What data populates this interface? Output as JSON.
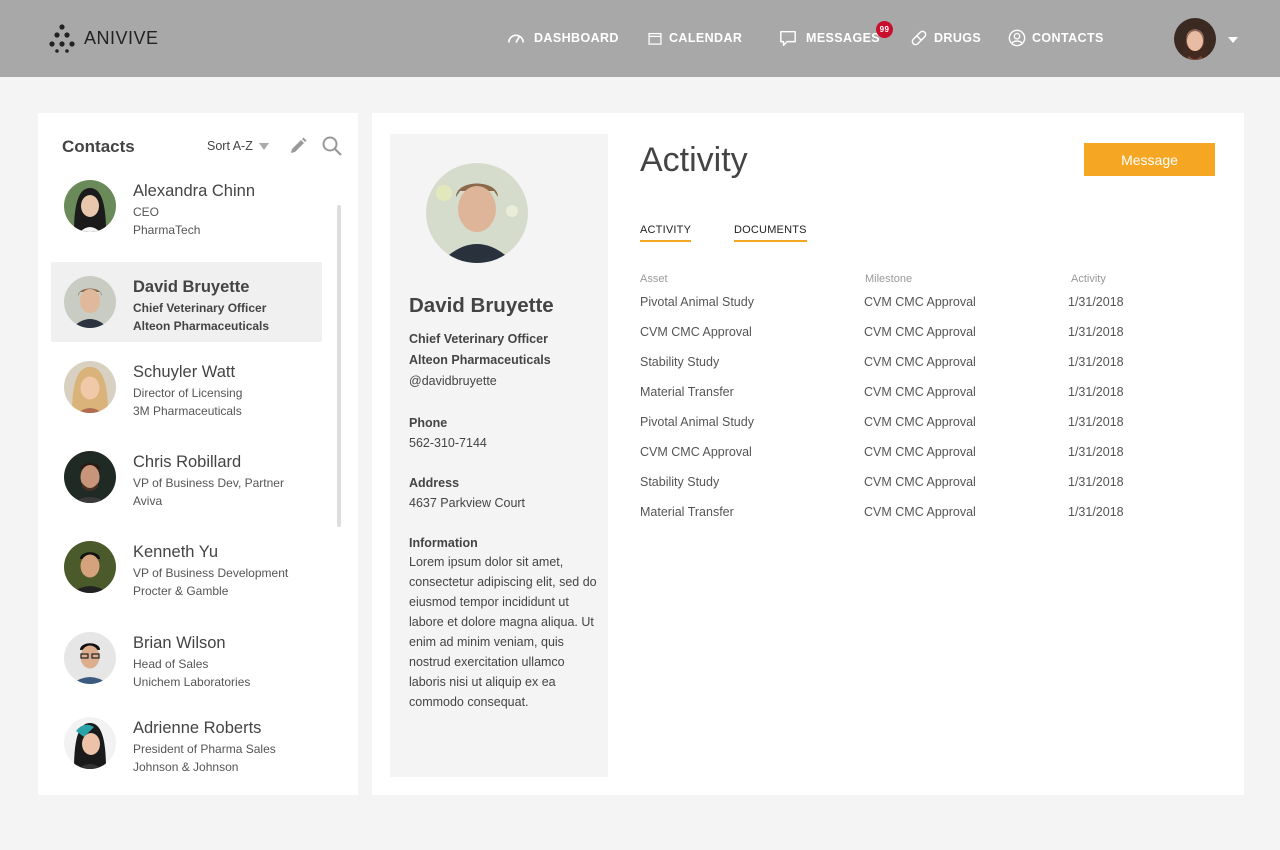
{
  "app": {
    "name": "ANIVIVE"
  },
  "nav": {
    "dashboard": "DASHBOARD",
    "calendar": "CALENDAR",
    "messages": "MESSAGES",
    "messages_badge": "99",
    "drugs": "DRUGS",
    "contacts": "CONTACTS"
  },
  "contacts_panel": {
    "title": "Contacts",
    "sort_label": "Sort A-Z",
    "items": [
      {
        "name": "Alexandra Chinn",
        "role": "CEO",
        "company": "PharmaTech"
      },
      {
        "name": "David Bruyette",
        "role": "Chief Veterinary Officer",
        "company": "Alteon Pharmaceuticals"
      },
      {
        "name": "Schuyler Watt",
        "role": "Director of Licensing",
        "company": "3M Pharmaceuticals"
      },
      {
        "name": "Chris Robillard",
        "role": "VP of Business Dev, Partner",
        "company": "Aviva"
      },
      {
        "name": "Kenneth Yu",
        "role": "VP of Business Development",
        "company": "Procter & Gamble"
      },
      {
        "name": "Brian Wilson",
        "role": "Head of Sales",
        "company": "Unichem Laboratories"
      },
      {
        "name": "Adrienne Roberts",
        "role": "President of Pharma Sales",
        "company": "Johnson & Johnson"
      }
    ]
  },
  "profile": {
    "name": "David Bruyette",
    "title": "Chief Veterinary Officer",
    "company": "Alteon Pharmaceuticals",
    "handle": "@davidbruyette",
    "phone_label": "Phone",
    "phone": "562-310-7144",
    "address_label": "Address",
    "address": "4637 Parkview Court",
    "info_label": "Information",
    "info": "Lorem ipsum dolor sit amet, consectetur adipiscing elit, sed do eiusmod tempor incididunt ut labore et dolore magna aliqua. Ut enim ad minim veniam, quis nostrud exercitation ullamco laboris nisi ut aliquip ex ea commodo consequat."
  },
  "activity": {
    "title": "Activity",
    "message_button": "Message",
    "tabs": [
      "ACTIVITY",
      "DOCUMENTS"
    ],
    "columns": [
      "Asset",
      "Milestone",
      "Activity"
    ],
    "rows": [
      [
        "Pivotal Animal Study",
        "CVM CMC Approval",
        "1/31/2018"
      ],
      [
        "CVM CMC Approval",
        "CVM CMC Approval",
        "1/31/2018"
      ],
      [
        "Stability Study",
        "CVM CMC Approval",
        "1/31/2018"
      ],
      [
        "Material Transfer",
        "CVM CMC Approval",
        "1/31/2018"
      ],
      [
        "Pivotal Animal Study",
        "CVM CMC Approval",
        "1/31/2018"
      ],
      [
        "CVM CMC Approval",
        "CVM CMC Approval",
        "1/31/2018"
      ],
      [
        "Stability Study",
        "CVM CMC Approval",
        "1/31/2018"
      ],
      [
        "Material Transfer",
        "CVM CMC Approval",
        "1/31/2018"
      ]
    ]
  },
  "colors": {
    "accent": "#f5a623",
    "topbar": "#a8a8a8",
    "badge": "#c8102e"
  }
}
